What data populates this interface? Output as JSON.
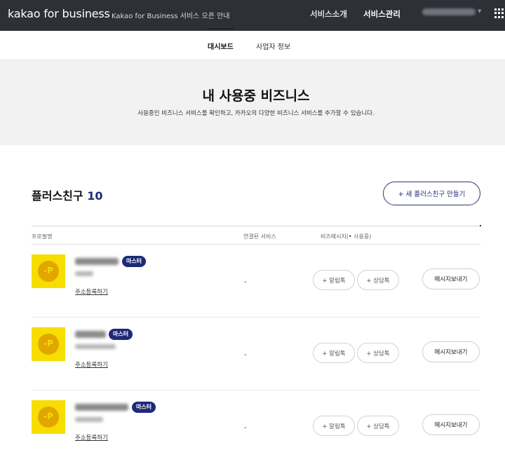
{
  "header": {
    "brand": "kakao for business",
    "notice": "Kakao for Business 서비스 오픈 안내",
    "nav": [
      "서비스소개",
      "서비스관리"
    ]
  },
  "subnav": {
    "tabs": [
      "대시보드",
      "사업자 정보"
    ],
    "active": "대시보드"
  },
  "hero": {
    "title": "내 사용중 비즈니스",
    "subtitle": "사용중인 비즈니스 서비스를 확인하고, 카카오의 다양한 비즈니스 서비스를 추가할 수 있습니다."
  },
  "section": {
    "title": "플러스친구",
    "count": "10",
    "create_button": "+ 새 플러스친구 만들기"
  },
  "table": {
    "columns": {
      "profile": "프로필명",
      "linked": "연결된 서비스",
      "biz_prefix": "비즈메시지(",
      "biz_dot": "•",
      "biz_suffix": " 사용중)"
    },
    "rows": [
      {
        "logo_glyph": "-P",
        "badge": "마스터",
        "address_link": "주소등록하기",
        "linked_service": "-",
        "alimtalk": "+ 알림톡",
        "sangdamtalk": "+ 상담톡",
        "send_button": "메시지보내기"
      },
      {
        "logo_glyph": "-P",
        "badge": "마스터",
        "address_link": "주소등록하기",
        "linked_service": "-",
        "alimtalk": "+ 알림톡",
        "sangdamtalk": "+ 상담톡",
        "send_button": "메시지보내기"
      },
      {
        "logo_glyph": "-P",
        "badge": "마스터",
        "address_link": "주소등록하기",
        "linked_service": "-",
        "alimtalk": "+ 알림톡",
        "sangdamtalk": "+ 상담톡",
        "send_button": "메시지보내기"
      }
    ]
  },
  "icons": {
    "account_caret": "chevron-down-icon",
    "apps": "apps-grid-icon",
    "logo": "plus-friend-icon"
  },
  "colors": {
    "topbar": "#2d3036",
    "accent_navy": "#1e2a78",
    "kakao_yellow": "#f7dd00",
    "hero_bg": "#f2f2f2"
  }
}
